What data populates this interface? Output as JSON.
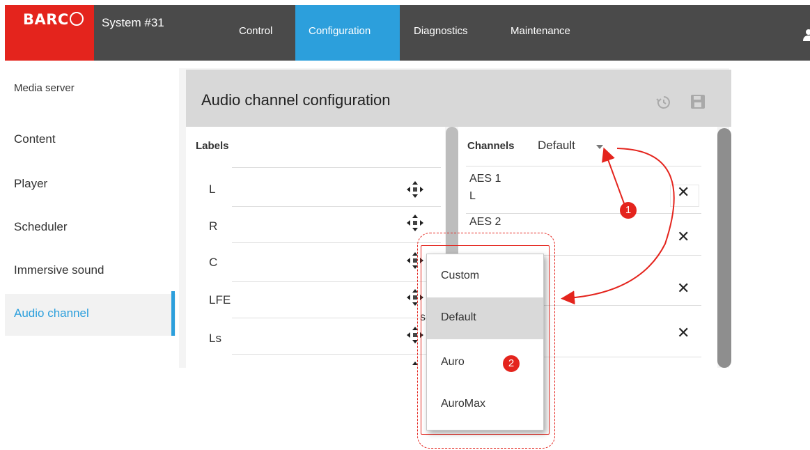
{
  "header": {
    "logo": "BARCO",
    "system_title": "System #31",
    "nav": [
      "Control",
      "Configuration",
      "Diagnostics",
      "Maintenance"
    ],
    "active_nav": "Configuration",
    "accent_color": "#2c9fdc",
    "brand_color": "#e4241d",
    "user_icon": "user-icon"
  },
  "sidebar": {
    "items": [
      "Media server",
      "Content",
      "Player",
      "Scheduler",
      "Immersive sound",
      "Audio channel"
    ],
    "active": "Audio channel"
  },
  "panel": {
    "title": "Audio channel configuration",
    "labels_header": "Labels",
    "labels": [
      "L",
      "R",
      "C",
      "LFE",
      "Ls"
    ],
    "channels_header": "Channels",
    "channels_preset": "Default",
    "channels": [
      {
        "name": "AES 1",
        "label": "L"
      },
      {
        "name": "AES 2",
        "label": ""
      }
    ],
    "overlap_text": "s"
  },
  "dropdown": {
    "options": [
      "Custom",
      "Default",
      "Auro",
      "AuroMax"
    ],
    "selected": "Default"
  },
  "callouts": [
    "1",
    "2"
  ]
}
